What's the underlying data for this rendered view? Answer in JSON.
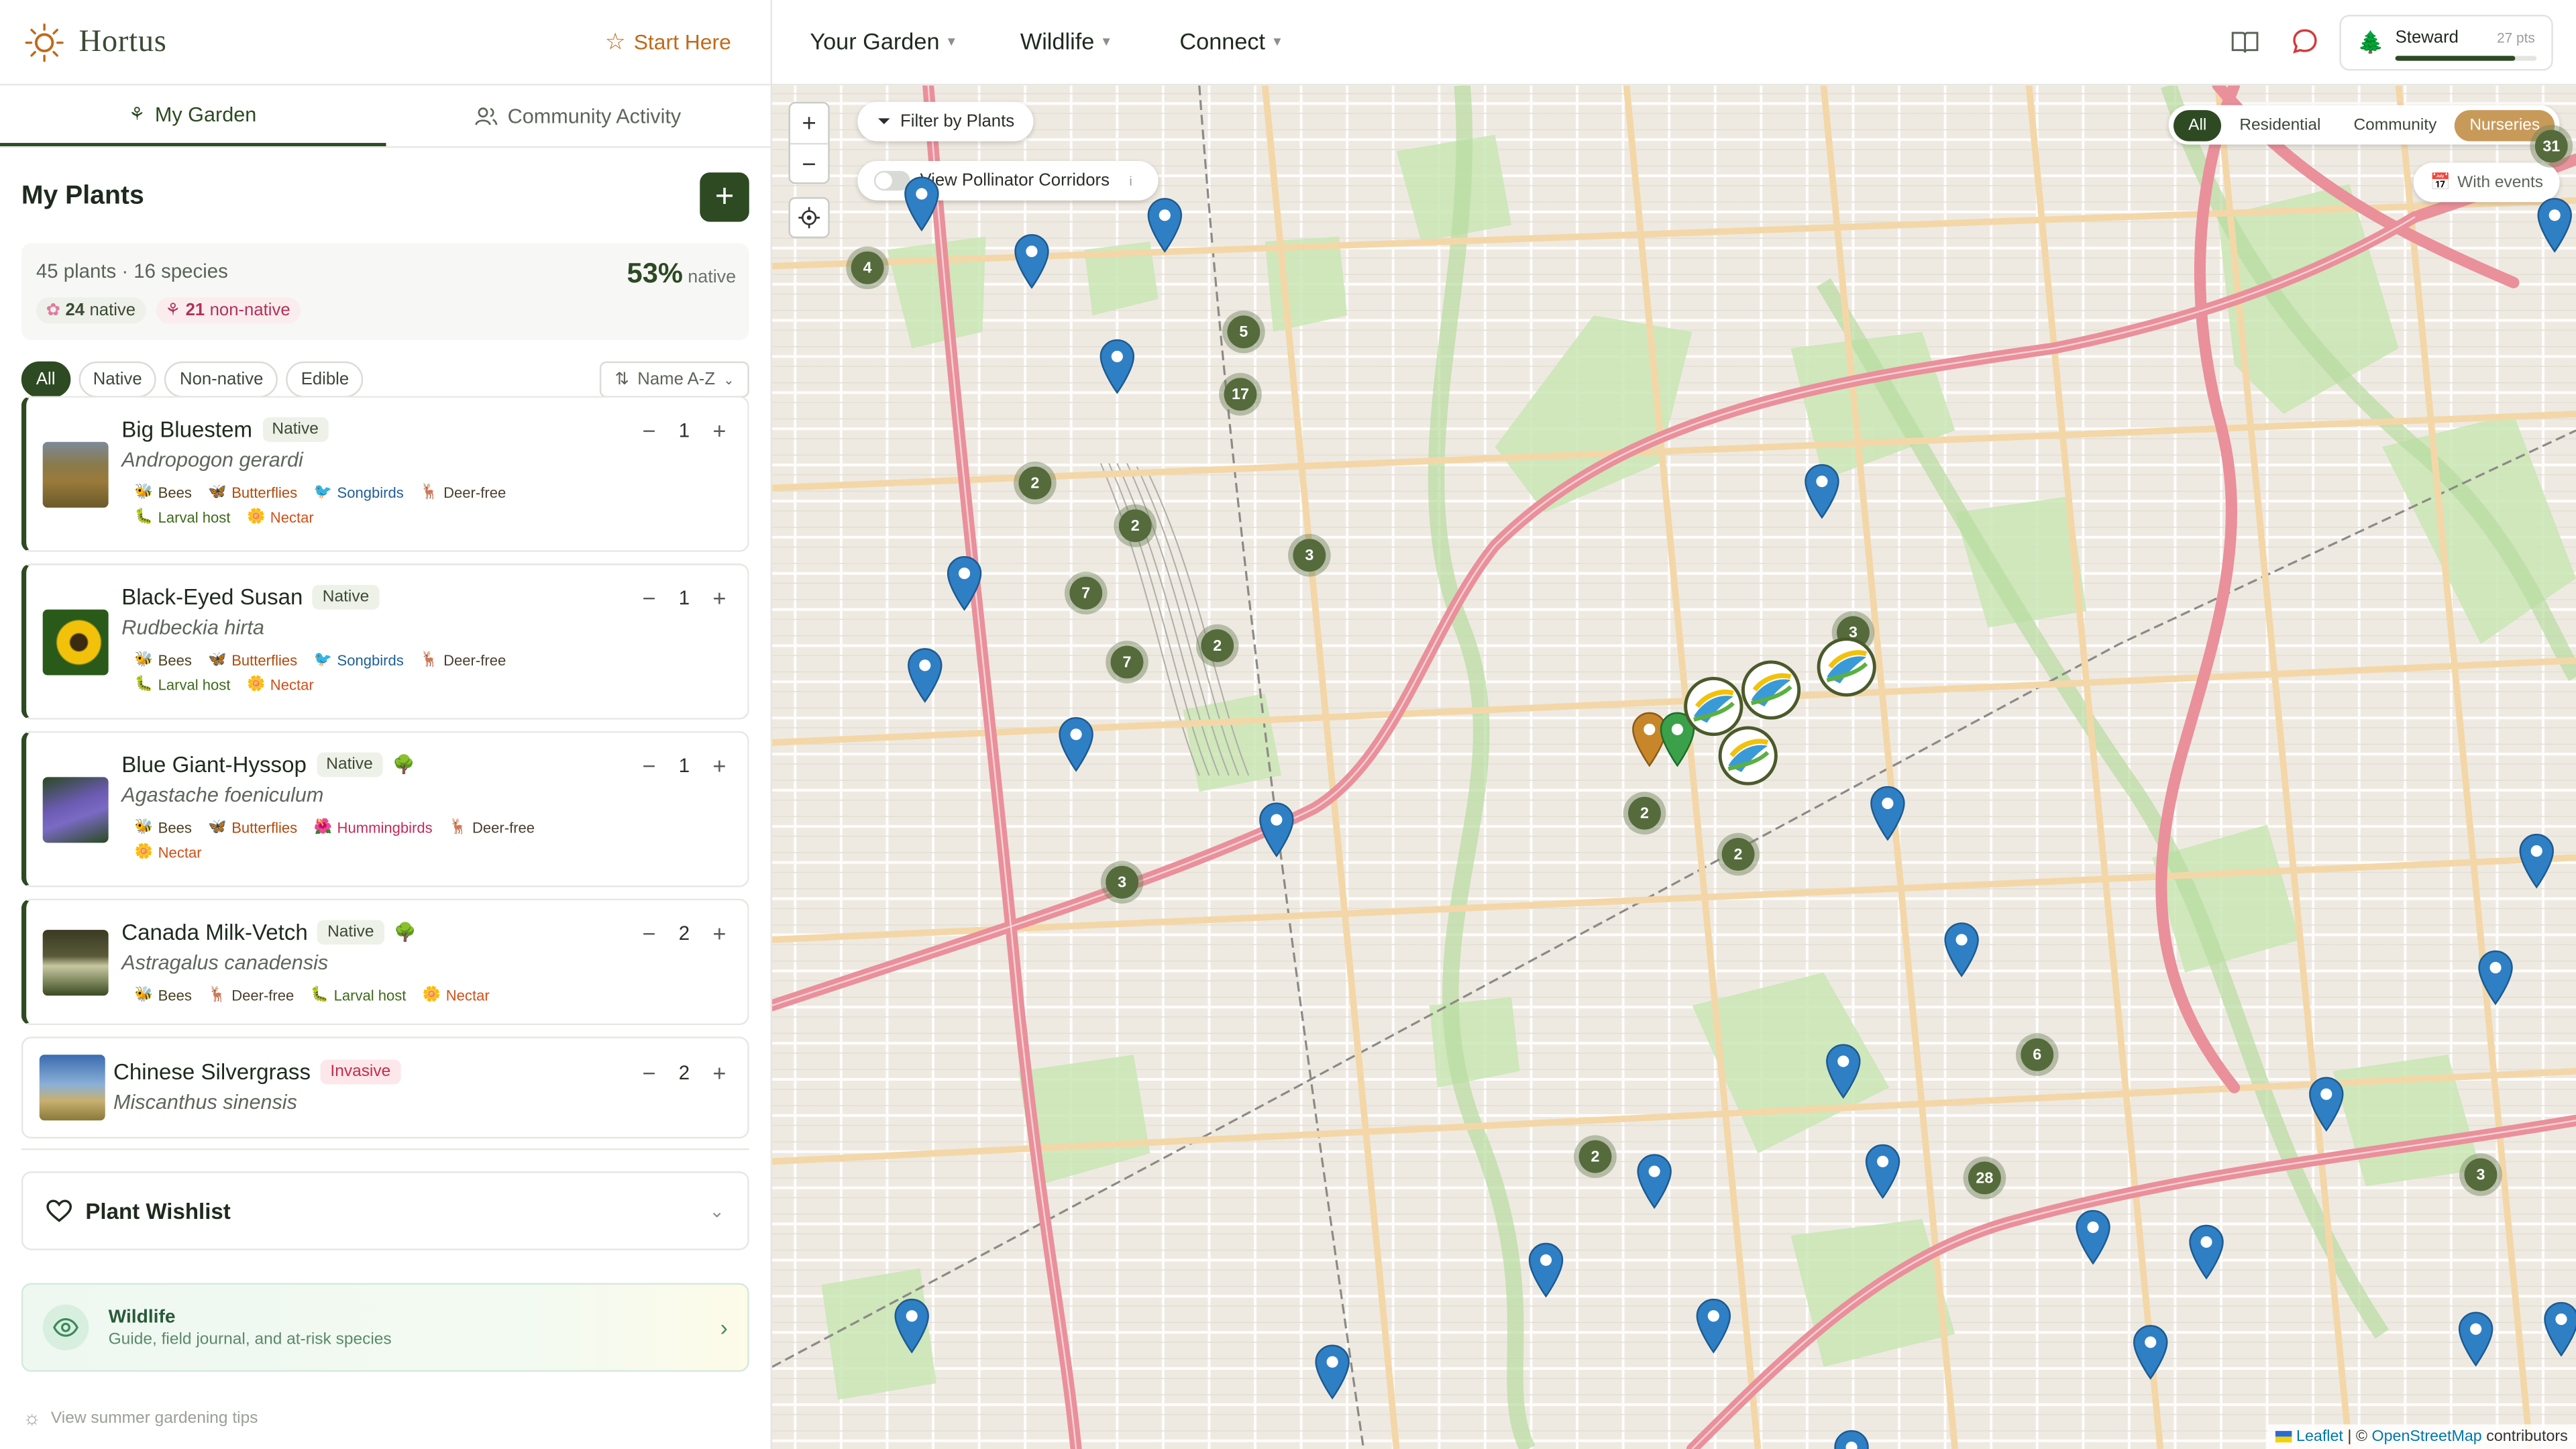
{
  "brand": {
    "name": "Hortus",
    "start_label": "Start Here"
  },
  "left_tabs": [
    {
      "label": "My Garden"
    },
    {
      "label": "Community Activity"
    }
  ],
  "plants": {
    "title": "My Plants",
    "stats_count": "45 plants · 16 species",
    "native_pct": "53%",
    "native_pct_label": "native",
    "native_count": "24",
    "native_label": "native",
    "nonnative_count": "21",
    "nonnative_label": "non-native"
  },
  "filters": [
    "All",
    "Native",
    "Non-native",
    "Edible"
  ],
  "sort_label": "Name A-Z",
  "cards": [
    {
      "name": "Big Bluestem",
      "badge": "Native",
      "scientific": "Andropogon gerardi",
      "qty": "1",
      "tags": [
        "Bees",
        "Butterflies",
        "Songbirds",
        "Deer-free",
        "Larval host",
        "Nectar"
      ]
    },
    {
      "name": "Black-Eyed Susan",
      "badge": "Native",
      "scientific": "Rudbeckia hirta",
      "qty": "1",
      "tags": [
        "Bees",
        "Butterflies",
        "Songbirds",
        "Deer-free",
        "Larval host",
        "Nectar"
      ]
    },
    {
      "name": "Blue Giant-Hyssop",
      "badge": "Native",
      "scientific": "Agastache foeniculum",
      "qty": "1",
      "tags": [
        "Bees",
        "Butterflies",
        "Hummingbirds",
        "Deer-free",
        "Nectar"
      ]
    },
    {
      "name": "Canada Milk-Vetch",
      "badge": "Native",
      "scientific": "Astragalus canadensis",
      "qty": "2",
      "tags": [
        "Bees",
        "Deer-free",
        "Larval host",
        "Nectar"
      ]
    },
    {
      "name": "Chinese Silvergrass",
      "badge": "Invasive",
      "scientific": "Miscanthus sinensis",
      "qty": "2",
      "tags": []
    }
  ],
  "wishlist": {
    "label": "Plant Wishlist"
  },
  "wildlife": {
    "title": "Wildlife",
    "subtitle": "Guide, field journal, and at-risk species"
  },
  "tips_label": "View summer gardening tips",
  "nav": {
    "items": [
      "Your Garden",
      "Wildlife",
      "Connect"
    ]
  },
  "steward": {
    "label": "Steward",
    "points": "27 pts",
    "progress": 0.85
  },
  "map": {
    "filter_label": "Filter by Plants",
    "corridors_label": "View Pollinator Corridors",
    "segments": [
      "All",
      "Residential",
      "Community",
      "Nurseries"
    ],
    "events_label": "With events",
    "clusters": [
      "4",
      "5",
      "17",
      "2",
      "2",
      "3",
      "7",
      "7",
      "2",
      "3",
      "2",
      "2",
      "3",
      "6",
      "2",
      "28",
      "3",
      "31"
    ],
    "attribution": {
      "leaflet": "Leaflet",
      "sep": "| ©",
      "osm": "OpenStreetMap",
      "tail": "contributors"
    }
  },
  "colors": {
    "primary": "#2d4a22",
    "accent": "#c06a1a",
    "pin": "#2f7fc4",
    "nursery": "#c89a5a"
  }
}
